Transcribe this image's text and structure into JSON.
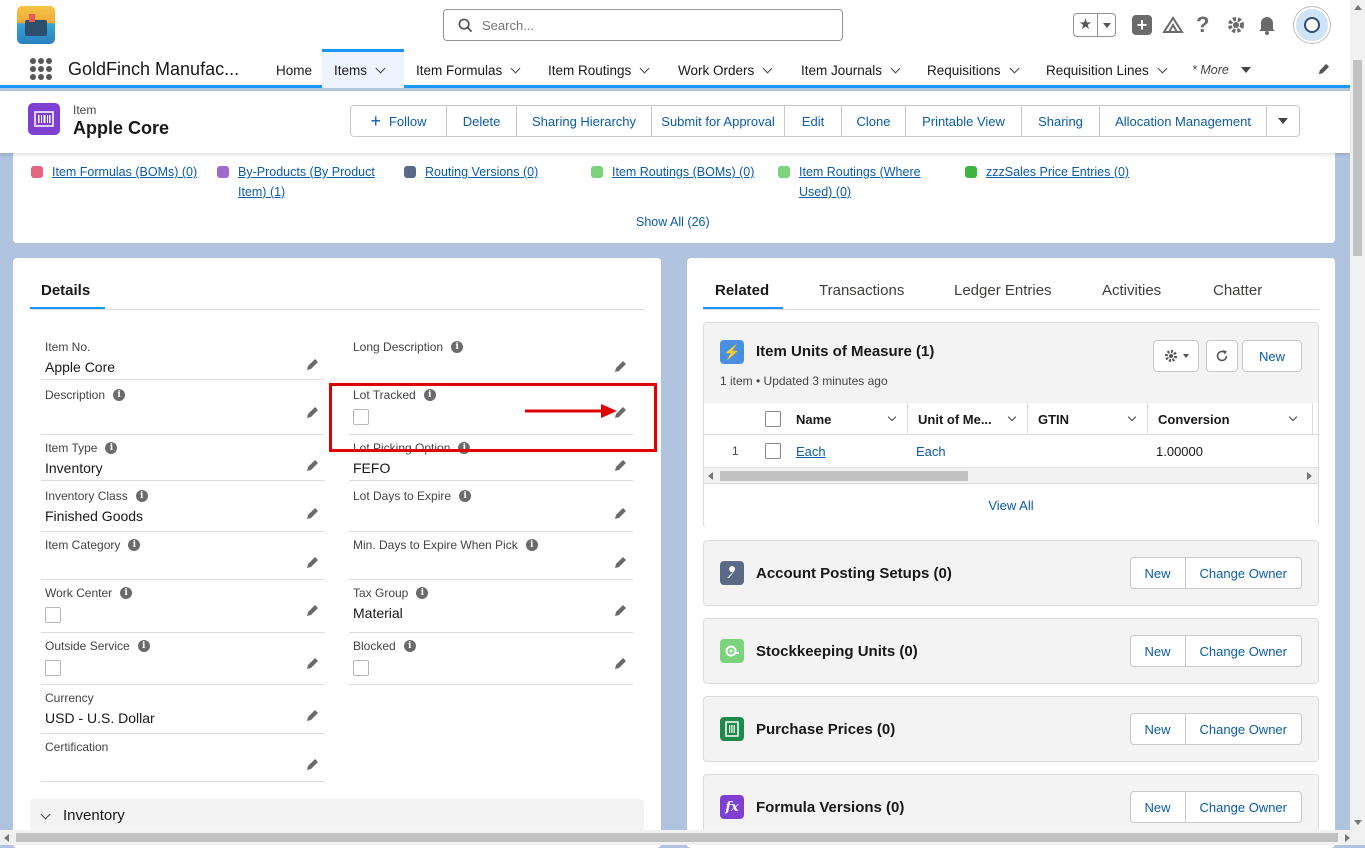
{
  "header": {
    "search_placeholder": "Search...",
    "app_name": "GoldFinch Manufac..."
  },
  "nav": {
    "items": [
      {
        "label": "Home"
      },
      {
        "label": "Items"
      },
      {
        "label": "Item Formulas"
      },
      {
        "label": "Item Routings"
      },
      {
        "label": "Work Orders"
      },
      {
        "label": "Item Journals"
      },
      {
        "label": "Requisitions"
      },
      {
        "label": "Requisition Lines"
      },
      {
        "label": "* More"
      }
    ]
  },
  "record": {
    "object_label": "Item",
    "name": "Apple Core",
    "actions": [
      "Follow",
      "Delete",
      "Sharing Hierarchy",
      "Submit for Approval",
      "Edit",
      "Clone",
      "Printable View",
      "Sharing",
      "Allocation Management"
    ]
  },
  "related_links": {
    "items": [
      {
        "line1": "Item Formulas (BOMs) (0)",
        "line2": "",
        "color": "#e3657f"
      },
      {
        "line1": "By-Products (By Product",
        "line2": "Item) (1)",
        "color": "#a06bd1"
      },
      {
        "line1": "Routing Versions (0)",
        "line2": "",
        "color": "#5a6a86"
      },
      {
        "line1": "Item Routings (BOMs) (0)",
        "line2": "",
        "color": "#7bd47b"
      },
      {
        "line1": "Item Routings (Where",
        "line2": "Used) (0)",
        "color": "#7bd47b"
      },
      {
        "line1": "zzzSales Price Entries (0)",
        "line2": "",
        "color": "#3fb43f"
      }
    ],
    "show_all": "Show All (26)"
  },
  "details": {
    "tab_label": "Details",
    "fields": {
      "item_no": {
        "label": "Item No.",
        "value": "Apple Core"
      },
      "long_description": {
        "label": "Long Description",
        "value": ""
      },
      "description": {
        "label": "Description",
        "value": ""
      },
      "lot_tracked": {
        "label": "Lot Tracked"
      },
      "item_type": {
        "label": "Item Type",
        "value": "Inventory"
      },
      "lot_picking_option": {
        "label": "Lot Picking Option",
        "value": "FEFO"
      },
      "inventory_class": {
        "label": "Inventory Class",
        "value": "Finished Goods"
      },
      "lot_days_to_expire": {
        "label": "Lot Days to Expire",
        "value": ""
      },
      "item_category": {
        "label": "Item Category",
        "value": ""
      },
      "min_days_to_expire": {
        "label": "Min. Days to Expire When Pick",
        "value": ""
      },
      "work_center": {
        "label": "Work Center"
      },
      "tax_group": {
        "label": "Tax Group",
        "value": "Material"
      },
      "outside_service": {
        "label": "Outside Service"
      },
      "blocked": {
        "label": "Blocked"
      },
      "currency": {
        "label": "Currency",
        "value": "USD - U.S. Dollar"
      },
      "certification": {
        "label": "Certification",
        "value": ""
      }
    },
    "section_inventory": "Inventory"
  },
  "related_panel": {
    "tabs": [
      "Related",
      "Transactions",
      "Ledger Entries",
      "Activities",
      "Chatter"
    ],
    "uom_card": {
      "title": "Item Units of Measure (1)",
      "meta": "1 item • Updated 3 minutes ago",
      "new_label": "New",
      "columns": [
        "Name",
        "Unit of Me...",
        "GTIN",
        "Conversion"
      ],
      "row": {
        "num": "1",
        "name": "Each",
        "unit": "Each",
        "conversion": "1.00000"
      },
      "view_all": "View All"
    },
    "cards": [
      {
        "title": "Account Posting Setups (0)",
        "new": "New",
        "change_owner": "Change Owner"
      },
      {
        "title": "Stockkeeping Units (0)",
        "new": "New",
        "change_owner": "Change Owner"
      },
      {
        "title": "Purchase Prices (0)",
        "new": "New",
        "change_owner": "Change Owner"
      },
      {
        "title": "Formula Versions (0)",
        "new": "New",
        "change_owner": "Change Owner"
      }
    ]
  },
  "colors": {
    "brand": "#1b96ff",
    "link": "#0b5cab",
    "annotation_red": "#e00000"
  }
}
